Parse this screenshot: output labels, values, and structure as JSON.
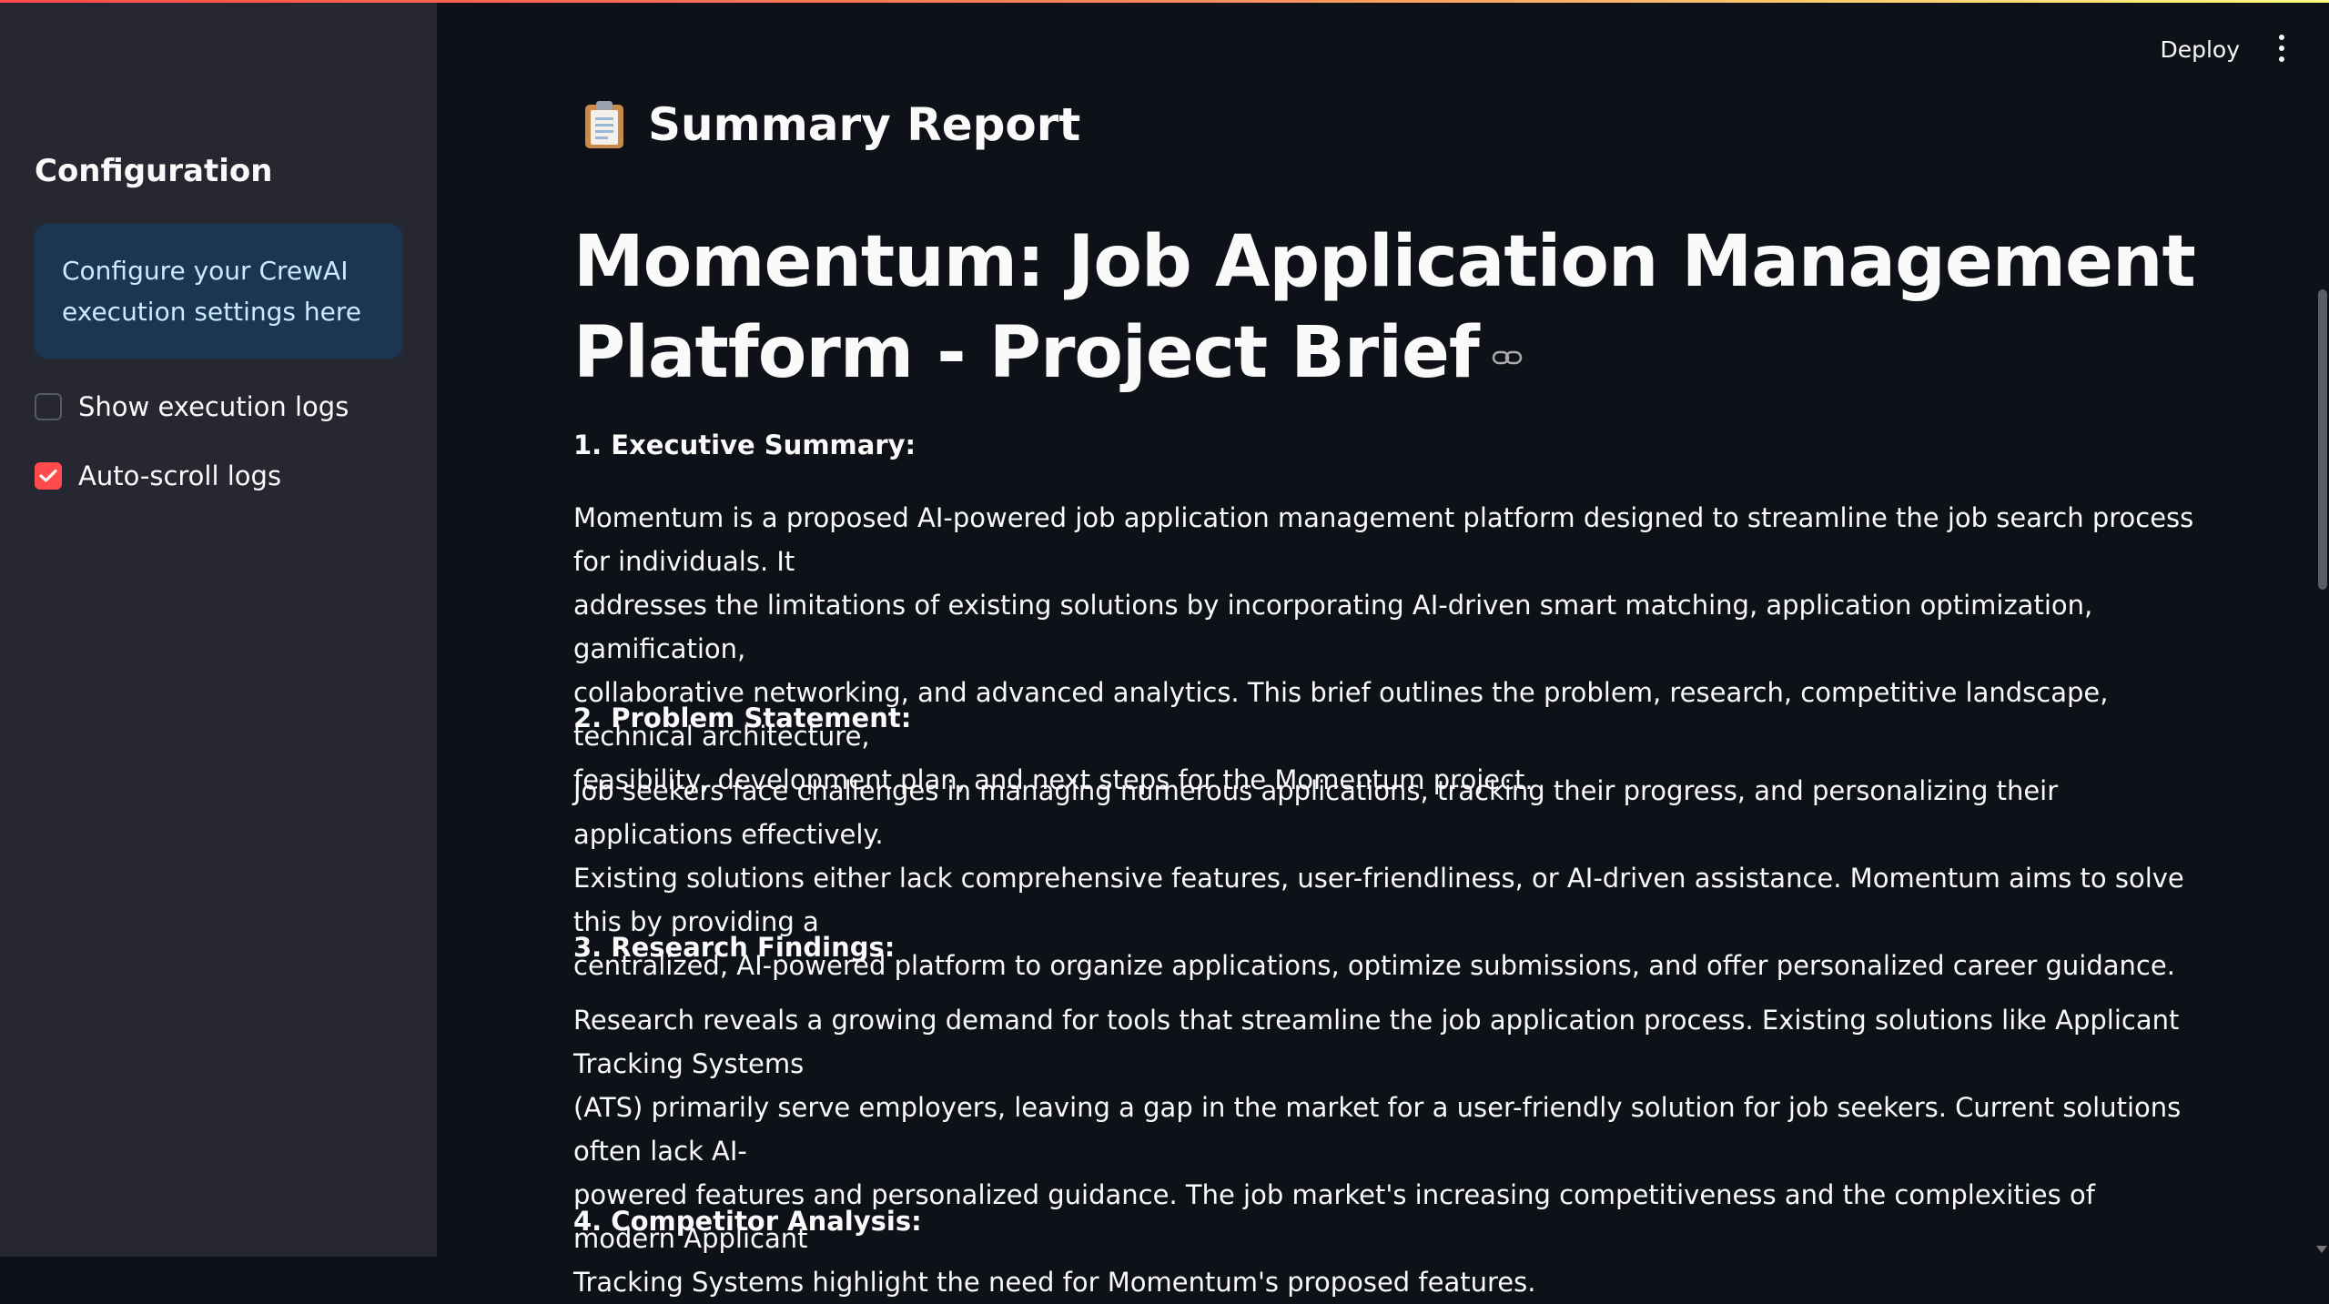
{
  "colors": {
    "sidebar_bg": "#262730",
    "main_bg": "#0e1117",
    "info_bg": "#1c3550",
    "info_text": "#c7ebff",
    "checkbox_checked": "#ff4b4b"
  },
  "sidebar": {
    "title": "Configuration",
    "info_text": "Configure your CrewAI execution settings here",
    "show_logs": {
      "label": "Show execution logs",
      "checked": false
    },
    "auto_scroll": {
      "label": "Auto-scroll logs",
      "checked": true
    }
  },
  "toolbar": {
    "deploy_label": "Deploy",
    "menu_icon": "kebab-menu-icon"
  },
  "main": {
    "header_icon": "clipboard-icon",
    "header": "Summary Report",
    "title_line1": "Momentum: Job Application Management",
    "title_line2": "Platform - Project Brief",
    "sections": [
      {
        "heading": "1. Executive Summary:",
        "lines": [
          "Momentum is a proposed AI-powered job application management platform designed to streamline the job search process for individuals. It",
          "addresses the limitations of existing solutions by incorporating AI-driven smart matching, application optimization, gamification,",
          "collaborative networking, and advanced analytics. This brief outlines the problem, research, competitive landscape, technical architecture,",
          "feasibility, development plan, and next steps for the Momentum project."
        ]
      },
      {
        "heading": "2. Problem Statement:",
        "lines": [
          "Job seekers face challenges in managing numerous applications, tracking their progress, and personalizing their applications effectively.",
          "Existing solutions either lack comprehensive features, user-friendliness, or AI-driven assistance. Momentum aims to solve this by providing a",
          "centralized, AI-powered platform to organize applications, optimize submissions, and offer personalized career guidance."
        ]
      },
      {
        "heading": "3. Research Findings:",
        "lines": [
          "Research reveals a growing demand for tools that streamline the job application process. Existing solutions like Applicant Tracking Systems",
          "(ATS) primarily serve employers, leaving a gap in the market for a user-friendly solution for job seekers. Current solutions often lack AI-",
          "powered features and personalized guidance. The job market's increasing competitiveness and the complexities of modern Applicant",
          "Tracking Systems highlight the need for Momentum's proposed features."
        ]
      },
      {
        "heading": "4. Competitor Analysis:",
        "lines": []
      }
    ]
  }
}
